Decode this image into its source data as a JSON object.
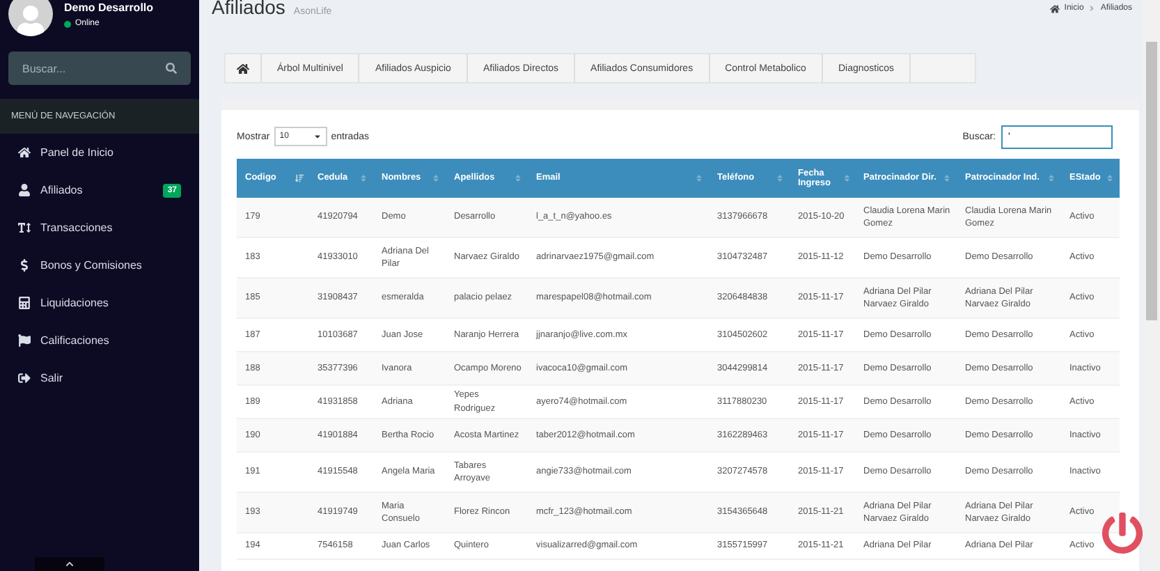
{
  "sidebar": {
    "user": {
      "name": "Demo Desarrollo",
      "status": "Online"
    },
    "search": {
      "placeholder": "Buscar..."
    },
    "nav_header": "MENÚ DE NAVEGACIÓN",
    "items": [
      {
        "kind": "home",
        "label": "Panel de Inicio"
      },
      {
        "kind": "user",
        "label": "Afiliados",
        "badge": "37"
      },
      {
        "kind": "text",
        "label": "Transacciones"
      },
      {
        "kind": "dollar",
        "label": "Bonos y Comisiones"
      },
      {
        "kind": "calc",
        "label": "Liquidaciones"
      },
      {
        "kind": "flag",
        "label": "Calificaciones"
      },
      {
        "kind": "exit",
        "label": "Salir"
      }
    ]
  },
  "header": {
    "title": "Afiliados",
    "subtitle": "AsonLife",
    "breadcrumb": [
      "Inicio",
      "Afiliados"
    ]
  },
  "tabs": [
    "Árbol Multinivel",
    "Afiliados Auspicio",
    "Afiliados Directos",
    "Afiliados Consumidores",
    "Control Metabolico",
    "Diagnosticos"
  ],
  "table_controls": {
    "show_label": "Mostrar",
    "page_size": "10",
    "entries_label": "entradas",
    "search_label": "Buscar:",
    "search_value": "'"
  },
  "table": {
    "columns": [
      {
        "label": "Codigo",
        "sorted": true
      },
      {
        "label": "Cedula",
        "sorted": false
      },
      {
        "label": "Nombres",
        "sorted": false
      },
      {
        "label": "Apellidos",
        "sorted": false
      },
      {
        "label": "Email",
        "sorted": false
      },
      {
        "label": "Teléfono",
        "sorted": false
      },
      {
        "label": "Fecha Ingreso",
        "sorted": false
      },
      {
        "label": "Patrocinador Dir.",
        "sorted": false
      },
      {
        "label": "Patrocinador Ind.",
        "sorted": false
      },
      {
        "label": "EStado",
        "sorted": false
      }
    ],
    "rows": [
      [
        "179",
        "41920794",
        "Demo",
        "Desarrollo",
        "l_a_t_n@yahoo.es",
        "3137966678",
        "2015-10-20",
        "Claudia Lorena Marin Gomez",
        "Claudia Lorena Marin Gomez",
        "Activo"
      ],
      [
        "183",
        "41933010",
        "Adriana Del Pilar",
        "Narvaez Giraldo",
        "adrinarvaez1975@gmail.com",
        "3104732487",
        "2015-11-12",
        "Demo Desarrollo",
        "Demo Desarrollo",
        "Activo"
      ],
      [
        "185",
        "31908437",
        "esmeralda",
        "palacio pelaez",
        "marespapel08@hotmail.com",
        "3206484838",
        "2015-11-17",
        "Adriana Del Pilar Narvaez Giraldo",
        "Adriana Del Pilar Narvaez Giraldo",
        "Activo"
      ],
      [
        "187",
        "10103687",
        "Juan Jose",
        "Naranjo Herrera",
        "jjnaranjo@live.com.mx",
        "3104502602",
        "2015-11-17",
        "Demo Desarrollo",
        "Demo Desarrollo",
        "Activo"
      ],
      [
        "188",
        "35377396",
        "Ivanora",
        "Ocampo Moreno",
        "ivacoca10@gmail.com",
        "3044299814",
        "2015-11-17",
        "Demo Desarrollo",
        "Demo Desarrollo",
        "Inactivo"
      ],
      [
        "189",
        "41931858",
        "Adriana",
        "Yepes Rodriguez",
        "ayero74@hotmail.com",
        "3117880230",
        "2015-11-17",
        "Demo Desarrollo",
        "Demo Desarrollo",
        "Activo"
      ],
      [
        "190",
        "41901884",
        "Bertha Rocio",
        "Acosta Martinez",
        "taber2012@hotmail.com",
        "3162289463",
        "2015-11-17",
        "Demo Desarrollo",
        "Demo Desarrollo",
        "Inactivo"
      ],
      [
        "191",
        "41915548",
        "Angela Maria",
        "Tabares Arroyave",
        "angie733@hotmail.com",
        "3207274578",
        "2015-11-17",
        "Demo Desarrollo",
        "Demo Desarrollo",
        "Inactivo"
      ],
      [
        "193",
        "41919749",
        "Maria Consuelo",
        "Florez Rincon",
        "mcfr_123@hotmail.com",
        "3154365648",
        "2015-11-21",
        "Adriana Del Pilar Narvaez Giraldo",
        "Adriana Del Pilar Narvaez Giraldo",
        "Activo"
      ],
      [
        "194",
        "7546158",
        "Juan Carlos",
        "Quintero",
        "visualizarred@gmail.com",
        "3155715997",
        "2015-11-21",
        "Adriana Del Pilar",
        "Adriana Del Pilar",
        "Activo"
      ]
    ]
  }
}
